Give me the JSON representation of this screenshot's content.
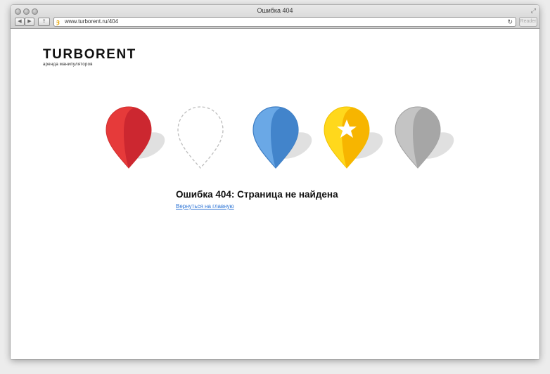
{
  "window": {
    "title": "Ошибка 404"
  },
  "toolbar": {
    "back_icon": "◀",
    "forward_icon": "▶",
    "share_icon": "⇪",
    "url": "www.turborent.ru/404",
    "reader_label": "Reader"
  },
  "page": {
    "logo": "TURBORENT",
    "tagline": "аренда манипуляторов",
    "error_title": "Ошибка 404: Страница не найдена",
    "home_link": "Вернуться на главную"
  },
  "pins": [
    {
      "name": "red",
      "fill": "#e63a3a",
      "shade": "#c8242a"
    },
    {
      "name": "empty",
      "fill": "none",
      "shade": "#c4c4c4"
    },
    {
      "name": "blue",
      "fill": "#5c9ee0",
      "shade": "#3e80c7"
    },
    {
      "name": "yellow",
      "fill": "#ffd21a",
      "shade": "#f3b300",
      "star": true
    },
    {
      "name": "gray",
      "fill": "#bfbfbf",
      "shade": "#a4a4a4"
    }
  ],
  "colors": {
    "link": "#2a72d4"
  }
}
